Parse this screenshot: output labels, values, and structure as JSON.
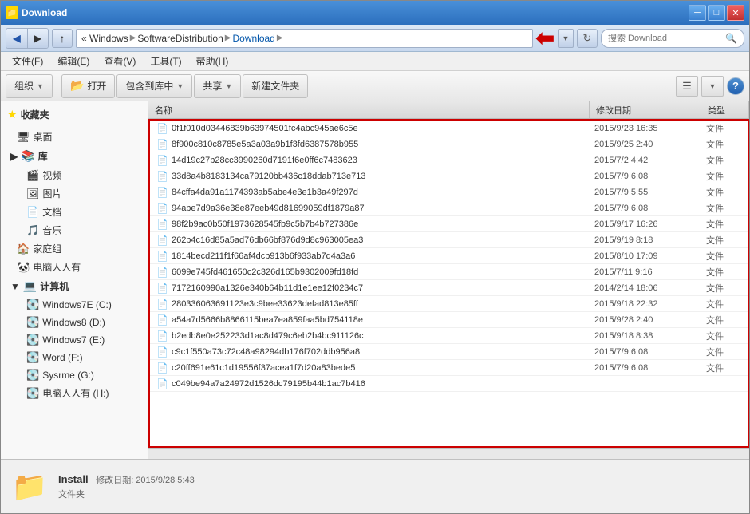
{
  "window": {
    "title": "Download",
    "icon": "📁"
  },
  "titlebar": {
    "minimize": "─",
    "maximize": "□",
    "close": "✕"
  },
  "addressbar": {
    "path_parts": [
      "Windows",
      "SoftwareDistribution",
      "Download"
    ],
    "search_placeholder": "搜索 Download"
  },
  "menubar": {
    "items": [
      "文件(F)",
      "编辑(E)",
      "查看(V)",
      "工具(T)",
      "帮助(H)"
    ]
  },
  "toolbar": {
    "organize": "组织",
    "open": "打开",
    "include_library": "包含到库中",
    "share": "共享",
    "new_folder": "新建文件夹"
  },
  "sidebar": {
    "favorites_label": "收藏夹",
    "desktop_label": "桌面",
    "library_label": "库",
    "videos_label": "视频",
    "pictures_label": "图片",
    "documents_label": "文档",
    "music_label": "音乐",
    "homegroup_label": "家庭组",
    "computer_people_label": "电脑人人有",
    "computer_label": "计算机",
    "win7e_label": "Windows7E (C:)",
    "win8_label": "Windows8 (D:)",
    "win7_label": "Windows7 (E:)",
    "word_label": "Word (F:)",
    "sysrme_label": "Sysrme (G:)",
    "people_label": "电脑人人有 (H:)"
  },
  "columns": {
    "name": "名称",
    "date": "修改日期",
    "type": "类型"
  },
  "files": [
    {
      "name": "0f1f010d03446839b63974501fc4abc945ae6c5e",
      "date": "2015/9/23 16:35",
      "type": "文件"
    },
    {
      "name": "8f900c810c8785e5a3a03a9b1f3fd6387578b955",
      "date": "2015/9/25 2:40",
      "type": "文件"
    },
    {
      "name": "14d19c27b28cc3990260d7191f6e0ff6c7483623",
      "date": "2015/7/2 4:42",
      "type": "文件"
    },
    {
      "name": "33d8a4b8183134ca79120bb436c18ddab713e713",
      "date": "2015/7/9 6:08",
      "type": "文件"
    },
    {
      "name": "84cffa4da91a1174393ab5abe4e3e1b3a49f297d",
      "date": "2015/7/9 5:55",
      "type": "文件"
    },
    {
      "name": "94abe7d9a36e38e87eeb49d81699059df1879a87",
      "date": "2015/7/9 6:08",
      "type": "文件"
    },
    {
      "name": "98f2b9ac0b50f1973628545fb9c5b7b4b727386e",
      "date": "2015/9/17 16:26",
      "type": "文件"
    },
    {
      "name": "262b4c16d85a5ad76db66bf876d9d8c963005ea3",
      "date": "2015/9/19 8:18",
      "type": "文件"
    },
    {
      "name": "1814becd211f1f66af4dcb913b6f933ab7d4a3a6",
      "date": "2015/8/10 17:09",
      "type": "文件"
    },
    {
      "name": "6099e745fd461650c2c326d165b9302009fd18fd",
      "date": "2015/7/11 9:16",
      "type": "文件"
    },
    {
      "name": "7172160990a1326e340b64b11d1e1ee12f0234c7",
      "date": "2014/2/14 18:06",
      "type": "文件"
    },
    {
      "name": "280336063691123e3c9bee33623defad813e85ff",
      "date": "2015/9/18 22:32",
      "type": "文件"
    },
    {
      "name": "a54a7d5666b8866115bea7ea859faa5bd754118e",
      "date": "2015/9/28 2:40",
      "type": "文件"
    },
    {
      "name": "b2edb8e0e252233d1ac8d479c6eb2b4bc911126c",
      "date": "2015/9/18 8:38",
      "type": "文件"
    },
    {
      "name": "c9c1f550a73c72c48a98294db176f702ddb956a8",
      "date": "2015/7/9 6:08",
      "type": "文件"
    },
    {
      "name": "c20ff691e61c1d19556f37acea1f7d20a83bede5",
      "date": "2015/7/9 6:08",
      "type": "文件"
    },
    {
      "name": "c049be94a7a24972d1526dc79195b44b1ac7b416",
      "date": "",
      "type": ""
    }
  ],
  "statusbar": {
    "folder_name": "Install",
    "detail": "修改日期: 2015/9/28 5:43",
    "type": "文件夹"
  }
}
